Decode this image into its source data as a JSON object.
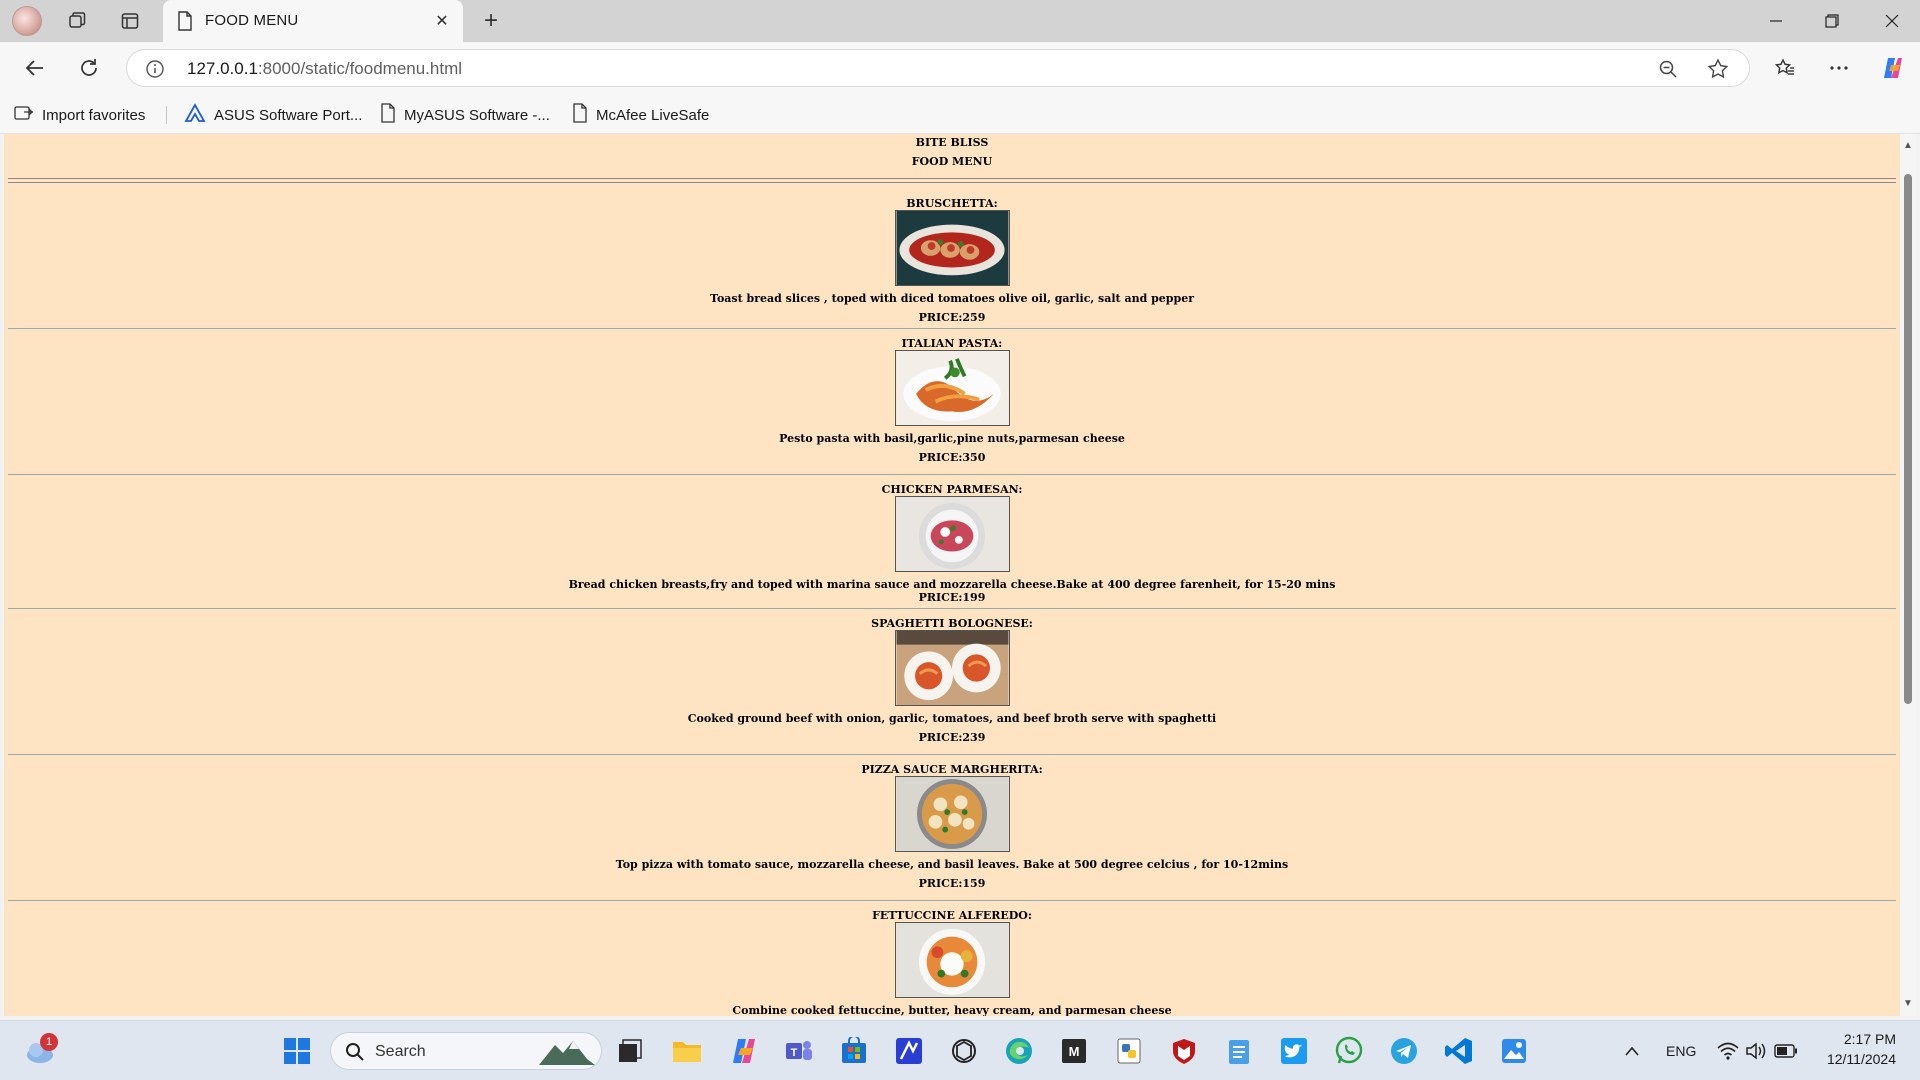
{
  "browser": {
    "tab_title": "FOOD MENU",
    "url_host": "127.0.0.1",
    "url_path": ":8000/static/foodmenu.html",
    "favorites": [
      {
        "label": "Import favorites",
        "icon": "import-icon"
      },
      {
        "label": "ASUS Software Port...",
        "icon": "asus-logo-icon"
      },
      {
        "label": "MyASUS Software -...",
        "icon": "page-icon"
      },
      {
        "label": "McAfee LiveSafe",
        "icon": "page-icon"
      }
    ]
  },
  "page": {
    "brand": "BITE BLISS",
    "subtitle": "FOOD MENU",
    "items": [
      {
        "name": "BRUSCHETTA:",
        "description": "Toast bread slices , toped with diced tomatoes olive oil, garlic, salt and pepper",
        "price": "PRICE:259"
      },
      {
        "name": "ITALIAN PASTA:",
        "description": "Pesto pasta with basil,garlic,pine nuts,parmesan cheese",
        "price": "PRICE:350"
      },
      {
        "name": "CHICKEN PARMESAN:",
        "description": "Bread chicken breasts,fry and toped with marina sauce and mozzarella cheese.Bake at 400 degree farenheit, for 15-20 mins",
        "price": "PRICE:199"
      },
      {
        "name": "SPAGHETTI BOLOGNESE:",
        "description": "Cooked ground beef with onion, garlic, tomatoes, and beef broth serve with spaghetti",
        "price": "PRICE:239"
      },
      {
        "name": "PIZZA SAUCE MARGHERITA:",
        "description": "Top pizza with tomato sauce, mozzarella cheese, and basil leaves. Bake at 500 degree celcius , for 10-12mins",
        "price": "PRICE:159"
      },
      {
        "name": "FETTUCCINE ALFEREDO:",
        "description": "Combine cooked fettuccine, butter, heavy cream, and parmesan cheese",
        "price": ""
      }
    ]
  },
  "taskbar": {
    "search_label": "Search",
    "weather_badge": "1",
    "language": "ENG",
    "time": "2:17 PM",
    "date": "12/11/2024"
  },
  "colors": {
    "page_background": "#ffe4c4",
    "accent": "#0067c0"
  }
}
